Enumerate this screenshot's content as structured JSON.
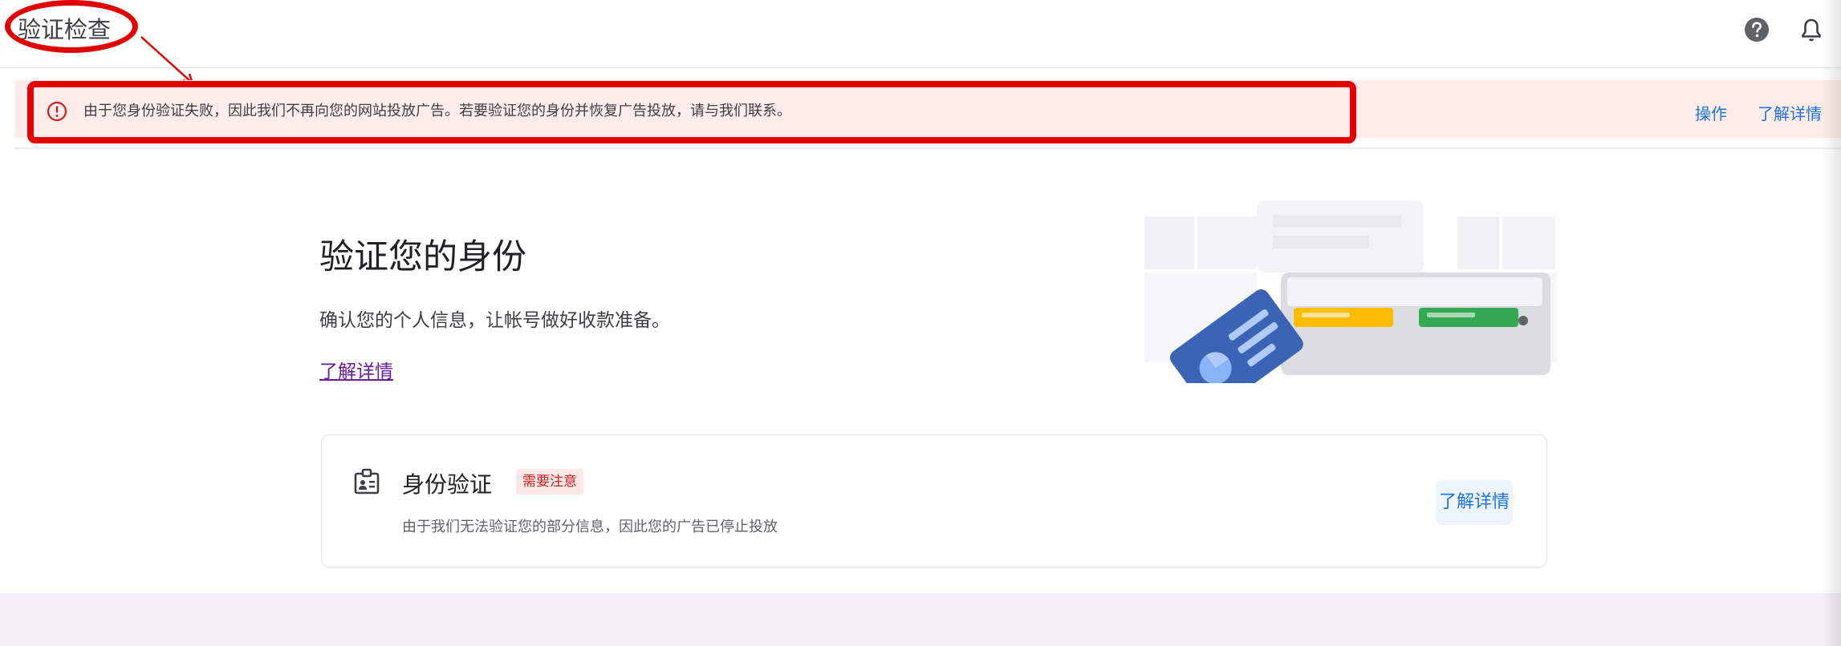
{
  "header": {
    "title": "验证检查",
    "help_icon": "help-circle-icon",
    "bell_icon": "bell-icon"
  },
  "banner": {
    "icon": "error-circle-icon",
    "message": "由于您身份验证失败，因此我们不再向您的网站投放广告。若要验证您的身份并恢复广告投放，请与我们联系。",
    "action_label": "操作",
    "learn_more_label": "了解详情"
  },
  "main": {
    "heading": "验证您的身份",
    "subtitle": "确认您的个人信息，让帐号做好收款准备。",
    "learn_more_label": "了解详情"
  },
  "card": {
    "icon": "id-badge-icon",
    "title": "身份验证",
    "badge": "需要注意",
    "description": "由于我们无法验证您的部分信息，因此您的广告已停止投放",
    "learn_more_label": "了解详情"
  },
  "colors": {
    "alert_red": "#e30000",
    "banner_bg": "#fdece9",
    "link_blue": "#1a73e8",
    "badge_bg": "#fce8e6",
    "badge_text": "#c5221f"
  }
}
